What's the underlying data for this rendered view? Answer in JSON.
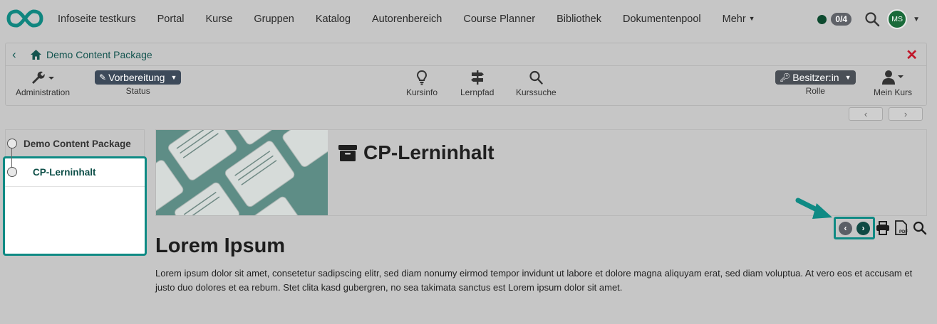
{
  "topnav": {
    "logo": "openolat-infinity-logo",
    "links": [
      {
        "label": "Infoseite testkurs"
      },
      {
        "label": "Portal"
      },
      {
        "label": "Kurse"
      },
      {
        "label": "Gruppen"
      },
      {
        "label": "Katalog"
      },
      {
        "label": "Autorenbereich"
      },
      {
        "label": "Course Planner"
      },
      {
        "label": "Bibliothek"
      },
      {
        "label": "Dokumentenpool"
      },
      {
        "label": "Mehr"
      }
    ],
    "status_badge": "0/4",
    "avatar_initials": "MS"
  },
  "course_toolbar": {
    "title": "Demo Content Package",
    "tools": {
      "administration": "Administration",
      "status_label": "Status",
      "status_value": "Vorbereitung",
      "kursinfo": "Kursinfo",
      "lernpfad": "Lernpfad",
      "kurssuche": "Kurssuche",
      "role_value": "Besitzer:in",
      "role_label": "Rolle",
      "mein_kurs": "Mein Kurs"
    }
  },
  "left_menu": {
    "root": "Demo Content Package",
    "items": [
      {
        "label": "CP-Lerninhalt",
        "active": true
      }
    ]
  },
  "main": {
    "page_title": "CP-Lerninhalt",
    "heading": "Lorem Ipsum",
    "body": "Lorem ipsum dolor sit amet, consetetur sadipscing elitr, sed diam nonumy eirmod tempor invidunt ut labore et dolore magna aliquyam erat, sed diam voluptua. At vero eos et accusam et justo duo dolores et ea rebum. Stet clita kasd gubergren, no sea takimata sanctus est Lorem ipsum dolor sit amet."
  },
  "colors": {
    "accent_teal": "#0f8a84",
    "brand_dark": "#0e4a44",
    "close_red": "#c0182b",
    "background": "#c6c6c6"
  }
}
